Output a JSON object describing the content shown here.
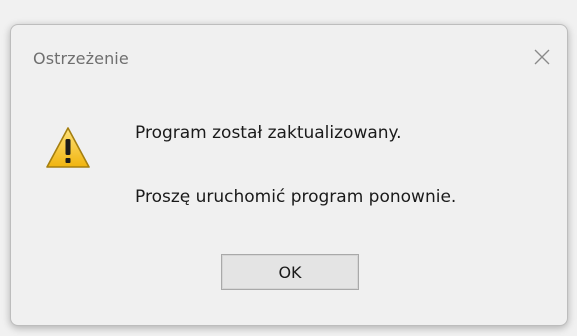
{
  "dialog": {
    "title": "Ostrzeżenie",
    "icon": "warning-icon",
    "close_icon": "close-icon",
    "message_line1": "Program został zaktualizowany.",
    "message_line2": "Proszę uruchomić program ponownie.",
    "ok_label": "OK"
  },
  "colors": {
    "warning_fill": "#f2c21b",
    "warning_border": "#9a7a12",
    "title_text": "#6f6f6f"
  }
}
